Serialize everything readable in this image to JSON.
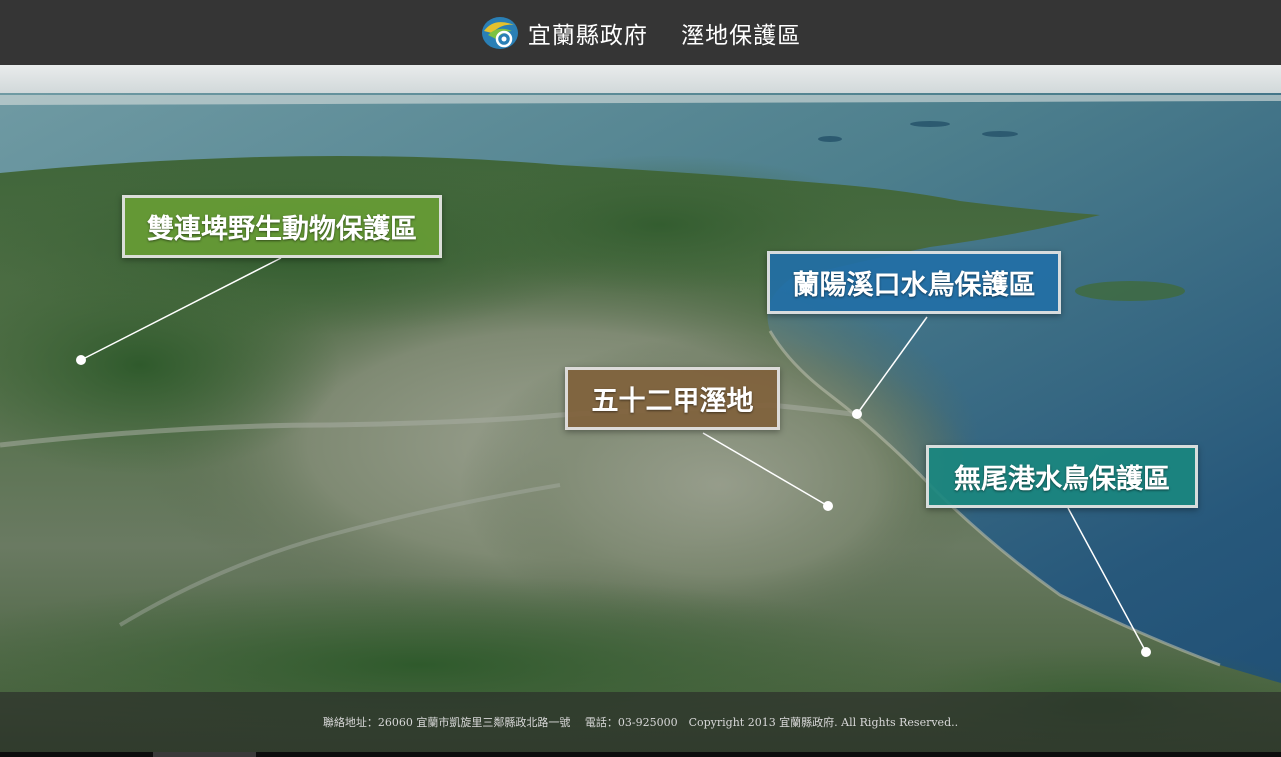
{
  "header": {
    "org": "宜蘭縣政府",
    "title": "溼地保護區"
  },
  "labels": {
    "shuanglian": "雙連埤野生動物保護區",
    "lanyang": "蘭陽溪口水鳥保護區",
    "wushier": "五十二甲溼地",
    "wuweigang": "無尾港水鳥保護區"
  },
  "footer": {
    "text": "聯絡地址：26060 宜蘭市凱旋里三鄰縣政北路一號　 電話：03-925000　Copyright 2013 宜蘭縣政府. All Rights Reserved.."
  },
  "colors": {
    "header_bg": "#353535",
    "green_label": "#679c35",
    "blue_label": "#226fa6",
    "brown_label": "#80623c",
    "teal_label": "#1a877f"
  }
}
